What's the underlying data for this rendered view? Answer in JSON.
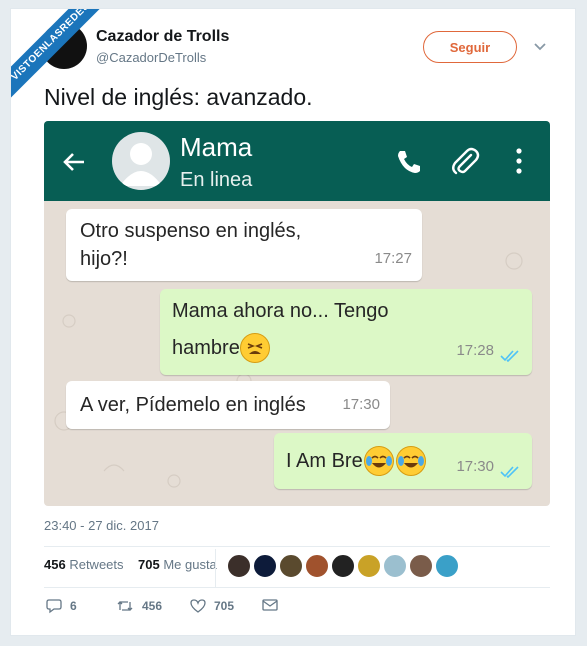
{
  "watermark": "VISTOENLASREDES",
  "author": {
    "name": "Cazador de Trolls",
    "handle": "@CazadorDeTrolls"
  },
  "follow_label": "Seguir",
  "tweet_text": "Nivel de inglés: avanzado.",
  "chat": {
    "contact_name": "Mama",
    "contact_status": "En linea",
    "messages": [
      {
        "direction": "in",
        "line1": "Otro suspenso en inglés,",
        "line2": "hijo?!",
        "time": "17:27"
      },
      {
        "direction": "out",
        "line1": "Mama ahora no... Tengo",
        "line2": "hambre",
        "time": "17:28",
        "emoji": "tired-face"
      },
      {
        "direction": "in",
        "line1": "A ver, Pídemelo en inglés",
        "time": "17:30"
      },
      {
        "direction": "out",
        "line1": "I Am Bre",
        "time": "17:30",
        "emoji": "tears-of-joy"
      }
    ],
    "header_color": "#075e54",
    "bubble_out_color": "#dcf8c6",
    "read_tick_color": "#4fc3f7"
  },
  "timestamp": "23:40 - 27 dic. 2017",
  "stats": {
    "retweets_count": "456",
    "retweets_label": "Retweets",
    "likes_count": "705",
    "likes_label": "Me gusta"
  },
  "actions": {
    "reply_count": "6",
    "retweet_count": "456",
    "like_count": "705"
  },
  "accent_color": "#e0683b"
}
